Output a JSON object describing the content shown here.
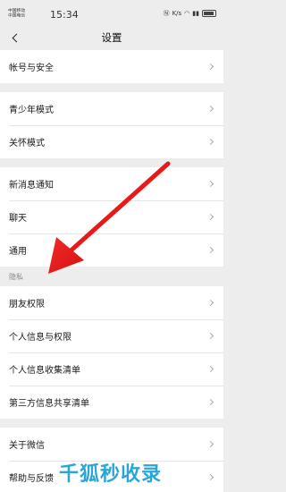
{
  "status_bar": {
    "carrier_1": "中国移动",
    "carrier_2": "中国电信",
    "time": "15:34",
    "speed": "K/s",
    "icons": [
      "nfc-icon",
      "wifi-icon",
      "signal-icon",
      "battery-icon"
    ]
  },
  "nav": {
    "title": "设置",
    "back_icon": "chevron-left-icon"
  },
  "groups": [
    {
      "items": [
        "帐号与安全"
      ]
    },
    {
      "items": [
        "青少年模式",
        "关怀模式"
      ]
    },
    {
      "items": [
        "新消息通知",
        "聊天",
        "通用"
      ]
    },
    {
      "header": "隐私",
      "items": [
        "朋友权限",
        "个人信息与权限",
        "个人信息收集清单",
        "第三方信息共享清单"
      ]
    },
    {
      "items": [
        "关于微信",
        "帮助与反馈"
      ]
    }
  ],
  "annotation": {
    "color": "#e81919",
    "points_to": "朋友权限"
  },
  "watermark": {
    "text": "千狐秒收录",
    "color": "#2aa6d6"
  }
}
